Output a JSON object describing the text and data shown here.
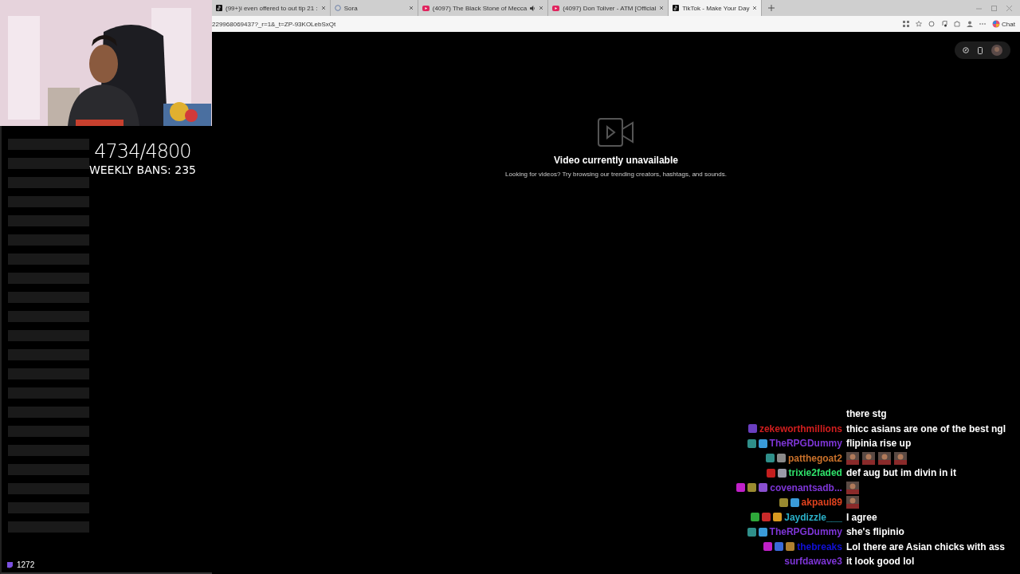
{
  "overlay": {
    "counter": "4734/4800",
    "weekly_bans": "WEEKLY BANS: 235"
  },
  "viewer_count": "1272",
  "tabs": [
    {
      "title": "(99+)i even offered to out tip 21 :",
      "kind": "note",
      "audio": false,
      "selected": false
    },
    {
      "title": "Sora",
      "kind": "ring",
      "audio": false,
      "selected": false
    },
    {
      "title": "(4097) The Black Stone of Mecca",
      "kind": "play",
      "audio": true,
      "selected": false
    },
    {
      "title": "(4097) Don Toliver - ATM [Official",
      "kind": "play",
      "audio": false,
      "selected": false
    },
    {
      "title": "TikTok - Make Your Day",
      "kind": "note",
      "audio": false,
      "selected": true
    }
  ],
  "address": "229968069437?_r=1&_t=ZP-93KOLebSxQt",
  "chat_button": "Chat",
  "notice": {
    "title": "Video currently unavailable",
    "text": "Looking for videos? Try browsing our trending creators, hashtags, and sounds."
  },
  "chat": [
    {
      "message": "there stg"
    },
    {
      "user": "zekeworthmillions",
      "color": "#d11e1e",
      "badges": [
        {
          "color": "#6a3fc0"
        }
      ],
      "message": "thicc asians are one of the best ngl"
    },
    {
      "user": "TheRPGDummy",
      "color": "#7d35d6",
      "badges": [
        {
          "color": "#2f8f8a"
        },
        {
          "color": "#3a9bd8"
        }
      ],
      "message": "flipinia rise up"
    },
    {
      "user": "patthegoat2",
      "color": "#c8702a",
      "badges": [
        {
          "color": "#2f8f8a"
        },
        {
          "color": "#8a8a8a"
        }
      ],
      "emotes": [
        {
          "kind": "picture"
        },
        {
          "kind": "picture"
        },
        {
          "kind": "picture"
        },
        {
          "kind": "picture"
        }
      ]
    },
    {
      "user": "trixie2faded",
      "color": "#2fe06a",
      "badges": [
        {
          "color": "#c41e1e"
        },
        {
          "color": "#9a9aa8"
        }
      ],
      "message": "def aug but im divin in it"
    },
    {
      "user": "covenantsadb...",
      "color": "#7d35d6",
      "badges": [
        {
          "color": "#c020c8"
        },
        {
          "color": "#9a8a30"
        },
        {
          "color": "#8a50d0"
        }
      ],
      "emotes": [
        {
          "kind": "picture"
        }
      ]
    },
    {
      "user": "akpaul89",
      "color": "#e0421e",
      "badges": [
        {
          "color": "#9a8a30"
        },
        {
          "color": "#3a9bd8"
        }
      ],
      "emotes": [
        {
          "kind": "picture"
        }
      ]
    },
    {
      "user": "Jaydizzle___",
      "color": "#2ab0c8",
      "badges": [
        {
          "color": "#2ea83a"
        },
        {
          "color": "#c82a2a"
        },
        {
          "color": "#d89a20"
        }
      ],
      "message": "I agree"
    },
    {
      "user": "TheRPGDummy",
      "color": "#7d35d6",
      "badges": [
        {
          "color": "#2f8f8a"
        },
        {
          "color": "#3a9bd8"
        }
      ],
      "message": "she's flipinio"
    },
    {
      "user": "thebreaks",
      "color": "#1010d8",
      "badges": [
        {
          "color": "#c020c8"
        },
        {
          "color": "#3a6ad8"
        },
        {
          "color": "#b08030"
        }
      ],
      "message": "Lol there are Asian chicks with ass"
    },
    {
      "user": "surfdawave3",
      "color": "#7d35d6",
      "message": "it look good lol"
    }
  ]
}
